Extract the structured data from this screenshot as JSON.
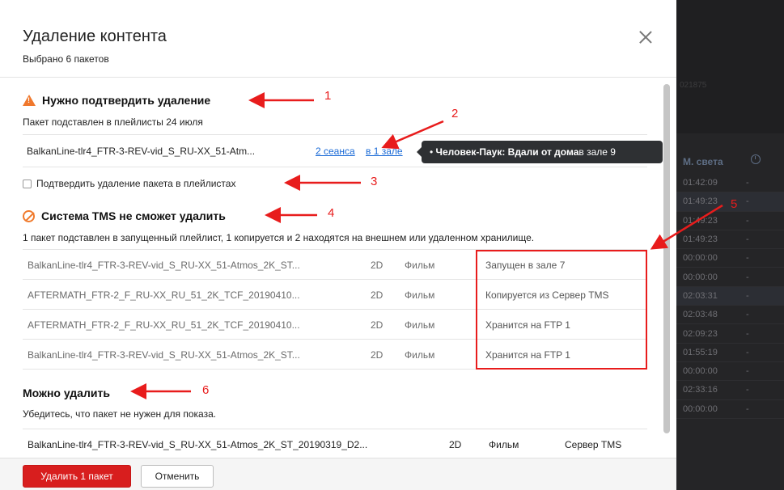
{
  "background_app": {
    "ghost_text": "021875",
    "column_header": "М. света",
    "clock_icon": "clock-icon",
    "rows": [
      {
        "time": "01:42:09",
        "dash": "-"
      },
      {
        "time": "01:49:23",
        "dash": "-"
      },
      {
        "time": "01:49:23",
        "dash": "-"
      },
      {
        "time": "01:49:23",
        "dash": "-"
      },
      {
        "time": "00:00:00",
        "dash": "-"
      },
      {
        "time": "00:00:00",
        "dash": "-"
      },
      {
        "time": "02:03:31",
        "dash": "-"
      },
      {
        "time": "02:03:48",
        "dash": "-"
      },
      {
        "time": "02:09:23",
        "dash": "-"
      },
      {
        "time": "01:55:19",
        "dash": "-"
      },
      {
        "time": "00:00:00",
        "dash": "-"
      },
      {
        "time": "02:33:16",
        "dash": "-"
      },
      {
        "time": "00:00:00",
        "dash": "-"
      }
    ]
  },
  "modal": {
    "title": "Удаление контента",
    "subtitle": "Выбрано 6 пакетов",
    "close_icon": "close-icon",
    "confirm_section": {
      "title": "Нужно подтвердить удаление",
      "icon": "warning-icon",
      "description": "Пакет подставлен в плейлисты 24 июля",
      "package_name": "BalkanLine-tlr4_FTR-3-REV-vid_S_RU-XX_51-Atm...",
      "sessions_link": "2 сеанса",
      "halls_link": "в 1 зале",
      "tooltip_bullet": "•",
      "tooltip_bold": "Человек-Паук: Вдали от дома",
      "tooltip_rest": " в зале 9",
      "checkbox_label": "Подтвердить удаление пакета в плейлистах"
    },
    "tms_section": {
      "title": "Система TMS не сможет удалить",
      "icon": "ban-icon",
      "description": "1 пакет подставлен в запущенный плейлист, 1 копируется и 2 находятся на внешнем или удаленном хранилище.",
      "rows": [
        {
          "name": "BalkanLine-tlr4_FTR-3-REV-vid_S_RU-XX_51-Atmos_2K_ST...",
          "format": "2D",
          "type": "Фильм",
          "status": "Запущен в зале 7"
        },
        {
          "name": "AFTERMATH_FTR-2_F_RU-XX_RU_51_2K_TCF_20190410...",
          "format": "2D",
          "type": "Фильм",
          "status": "Копируется из Сервер TMS"
        },
        {
          "name": "AFTERMATH_FTR-2_F_RU-XX_RU_51_2K_TCF_20190410...",
          "format": "2D",
          "type": "Фильм",
          "status": "Хранится на FTP 1"
        },
        {
          "name": "BalkanLine-tlr4_FTR-3-REV-vid_S_RU-XX_51-Atmos_2K_ST...",
          "format": "2D",
          "type": "Фильм",
          "status": "Хранится на FTP 1"
        }
      ]
    },
    "deletable_section": {
      "title": "Можно удалить",
      "description": "Убедитесь, что пакет не нужен для показа.",
      "row": {
        "name": "BalkanLine-tlr4_FTR-3-REV-vid_S_RU-XX_51-Atmos_2K_ST_20190319_D2...",
        "format": "2D",
        "type": "Фильм",
        "location": "Сервер TMS"
      }
    },
    "footer": {
      "delete_label": "Удалить 1 пакет",
      "cancel_label": "Отменить"
    }
  },
  "annotations": {
    "labels": [
      "1",
      "2",
      "3",
      "4",
      "5",
      "6"
    ],
    "color": "#e81c1c"
  },
  "colors": {
    "link": "#1a6ad6",
    "danger_button": "#d81e1e",
    "warning": "#f0782d",
    "tooltip_bg": "#2e3033"
  }
}
